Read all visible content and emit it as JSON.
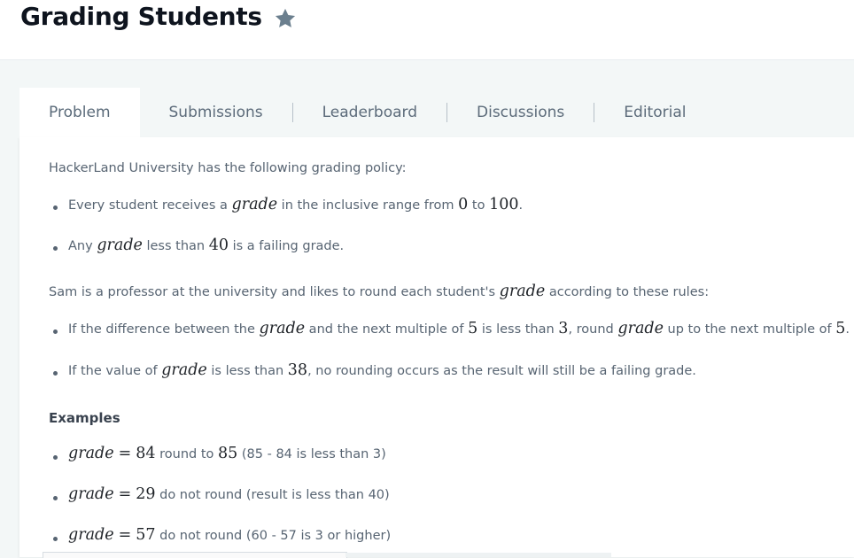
{
  "page": {
    "title": "Grading Students",
    "star_icon": "star-icon"
  },
  "tabs": [
    {
      "label": "Problem",
      "active": true
    },
    {
      "label": "Submissions",
      "active": false
    },
    {
      "label": "Leaderboard",
      "active": false
    },
    {
      "label": "Discussions",
      "active": false
    },
    {
      "label": "Editorial",
      "active": false
    }
  ],
  "problem": {
    "intro": "HackerLand University has the following grading policy:",
    "policy": {
      "item1": {
        "a": "Every student receives a ",
        "var": "grade",
        "b": " in the inclusive range from ",
        "n1": "0",
        "c": " to ",
        "n2": "100",
        "d": "."
      },
      "item2": {
        "a": "Any ",
        "var": "grade",
        "b": " less than ",
        "n1": "40",
        "c": " is a failing grade."
      }
    },
    "sam": {
      "a": "Sam is a professor at the university and likes to round each student's ",
      "var": "grade",
      "b": " according to these rules:"
    },
    "rules": {
      "item1": {
        "a": "If the difference between the ",
        "var1": "grade",
        "b": " and the next multiple of ",
        "n1": "5",
        "c": " is less than ",
        "n2": "3",
        "d": ", round ",
        "var2": "grade",
        "e": " up to the next multiple of ",
        "n3": "5",
        "f": "."
      },
      "item2": {
        "a": "If the value of ",
        "var": "grade",
        "b": " is less than ",
        "n1": "38",
        "c": ", no rounding occurs as the result will still be a failing grade."
      }
    },
    "examples_heading": "Examples",
    "examples": {
      "ex1": {
        "var": "grade",
        "eq": "=",
        "n": "84",
        "a": " round to ",
        "n2": "85",
        "b": " (85 - 84 is less than 3)"
      },
      "ex2": {
        "var": "grade",
        "eq": "=",
        "n": "29",
        "a": " do not round (result is less than 40)"
      },
      "ex3": {
        "var": "grade",
        "eq": "=",
        "n": "57",
        "a": " do not round (60 - 57 is 3 or higher)"
      }
    }
  },
  "colors": {
    "title": "#0e141e",
    "body_text": "#576472",
    "band_bg": "#f3f7f7",
    "star": "#6b7f8e"
  }
}
